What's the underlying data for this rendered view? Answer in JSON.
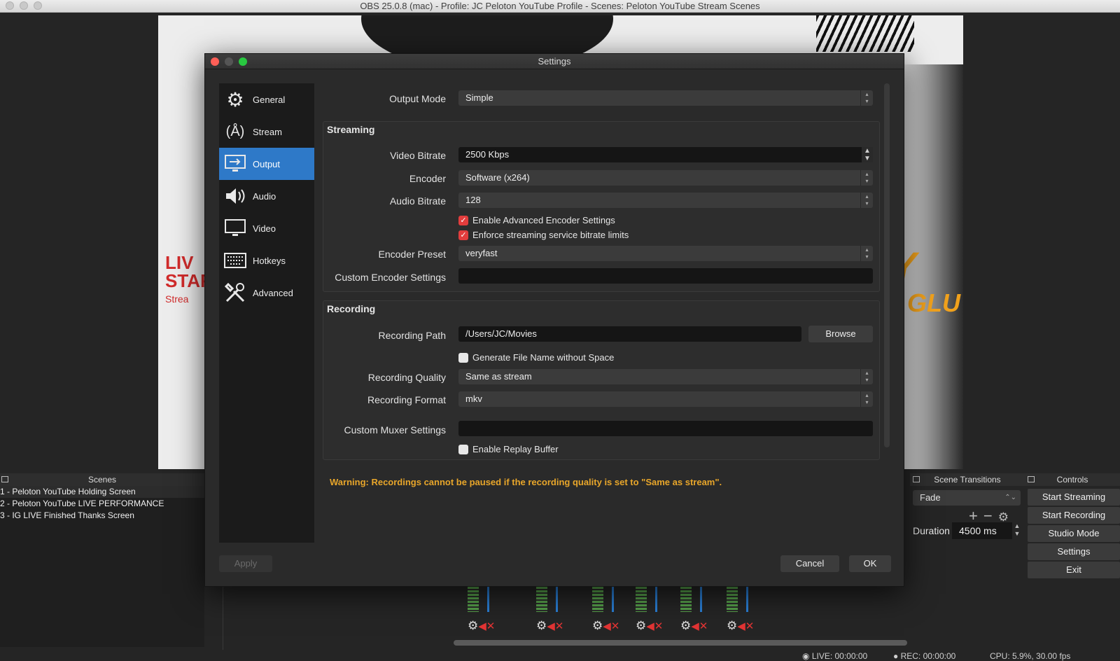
{
  "window": {
    "title": "OBS 25.0.8 (mac) - Profile: JC Peloton YouTube Profile - Scenes: Peloton YouTube Stream Scenes"
  },
  "preview": {
    "left_text": "LIV\nSTAR",
    "left_sub": "Strea",
    "right_text": "Y",
    "right_sub": "GLU"
  },
  "docks": {
    "scenes_title": "Scenes",
    "scenes": [
      "1 - Peloton YouTube Holding Screen",
      "2 - Peloton YouTube LIVE PERFORMANCE",
      "3 - IG LIVE Finished Thanks Screen"
    ],
    "transitions_title": "Scene Transitions",
    "transition_value": "Fade",
    "duration_label": "Duration",
    "duration_value": "4500 ms",
    "controls_title": "Controls",
    "controls": [
      "Start Streaming",
      "Start Recording",
      "Studio Mode",
      "Settings",
      "Exit"
    ]
  },
  "status": {
    "live": "LIVE: 00:00:00",
    "rec": "REC: 00:00:00",
    "cpu": "CPU: 5.9%, 30.00 fps"
  },
  "dialog": {
    "title": "Settings",
    "sidebar": [
      {
        "label": "General",
        "icon": "gear-icon"
      },
      {
        "label": "Stream",
        "icon": "antenna-icon"
      },
      {
        "label": "Output",
        "icon": "monitor-arrow-icon"
      },
      {
        "label": "Audio",
        "icon": "speaker-icon"
      },
      {
        "label": "Video",
        "icon": "monitor-icon"
      },
      {
        "label": "Hotkeys",
        "icon": "keyboard-icon"
      },
      {
        "label": "Advanced",
        "icon": "tools-icon"
      }
    ],
    "active_item": "Output",
    "output_mode_label": "Output Mode",
    "output_mode_value": "Simple",
    "streaming": {
      "title": "Streaming",
      "video_bitrate_label": "Video Bitrate",
      "video_bitrate_value": "2500 Kbps",
      "encoder_label": "Encoder",
      "encoder_value": "Software (x264)",
      "audio_bitrate_label": "Audio Bitrate",
      "audio_bitrate_value": "128",
      "enable_advanced_label": "Enable Advanced Encoder Settings",
      "enforce_limits_label": "Enforce streaming service bitrate limits",
      "encoder_preset_label": "Encoder Preset",
      "encoder_preset_value": "veryfast",
      "custom_encoder_label": "Custom Encoder Settings",
      "custom_encoder_value": ""
    },
    "recording": {
      "title": "Recording",
      "path_label": "Recording Path",
      "path_value": "/Users/JC/Movies",
      "browse_label": "Browse",
      "no_space_label": "Generate File Name without Space",
      "quality_label": "Recording Quality",
      "quality_value": "Same as stream",
      "format_label": "Recording Format",
      "format_value": "mkv",
      "muxer_label": "Custom Muxer Settings",
      "muxer_value": "",
      "replay_label": "Enable Replay Buffer"
    },
    "warning": "Warning: Recordings cannot be paused if the recording quality is set to \"Same as stream\".",
    "apply_label": "Apply",
    "cancel_label": "Cancel",
    "ok_label": "OK"
  },
  "colors": {
    "accent": "#2e79c8",
    "checkbox_on": "#e23d3d",
    "warning": "#e8a62a"
  }
}
